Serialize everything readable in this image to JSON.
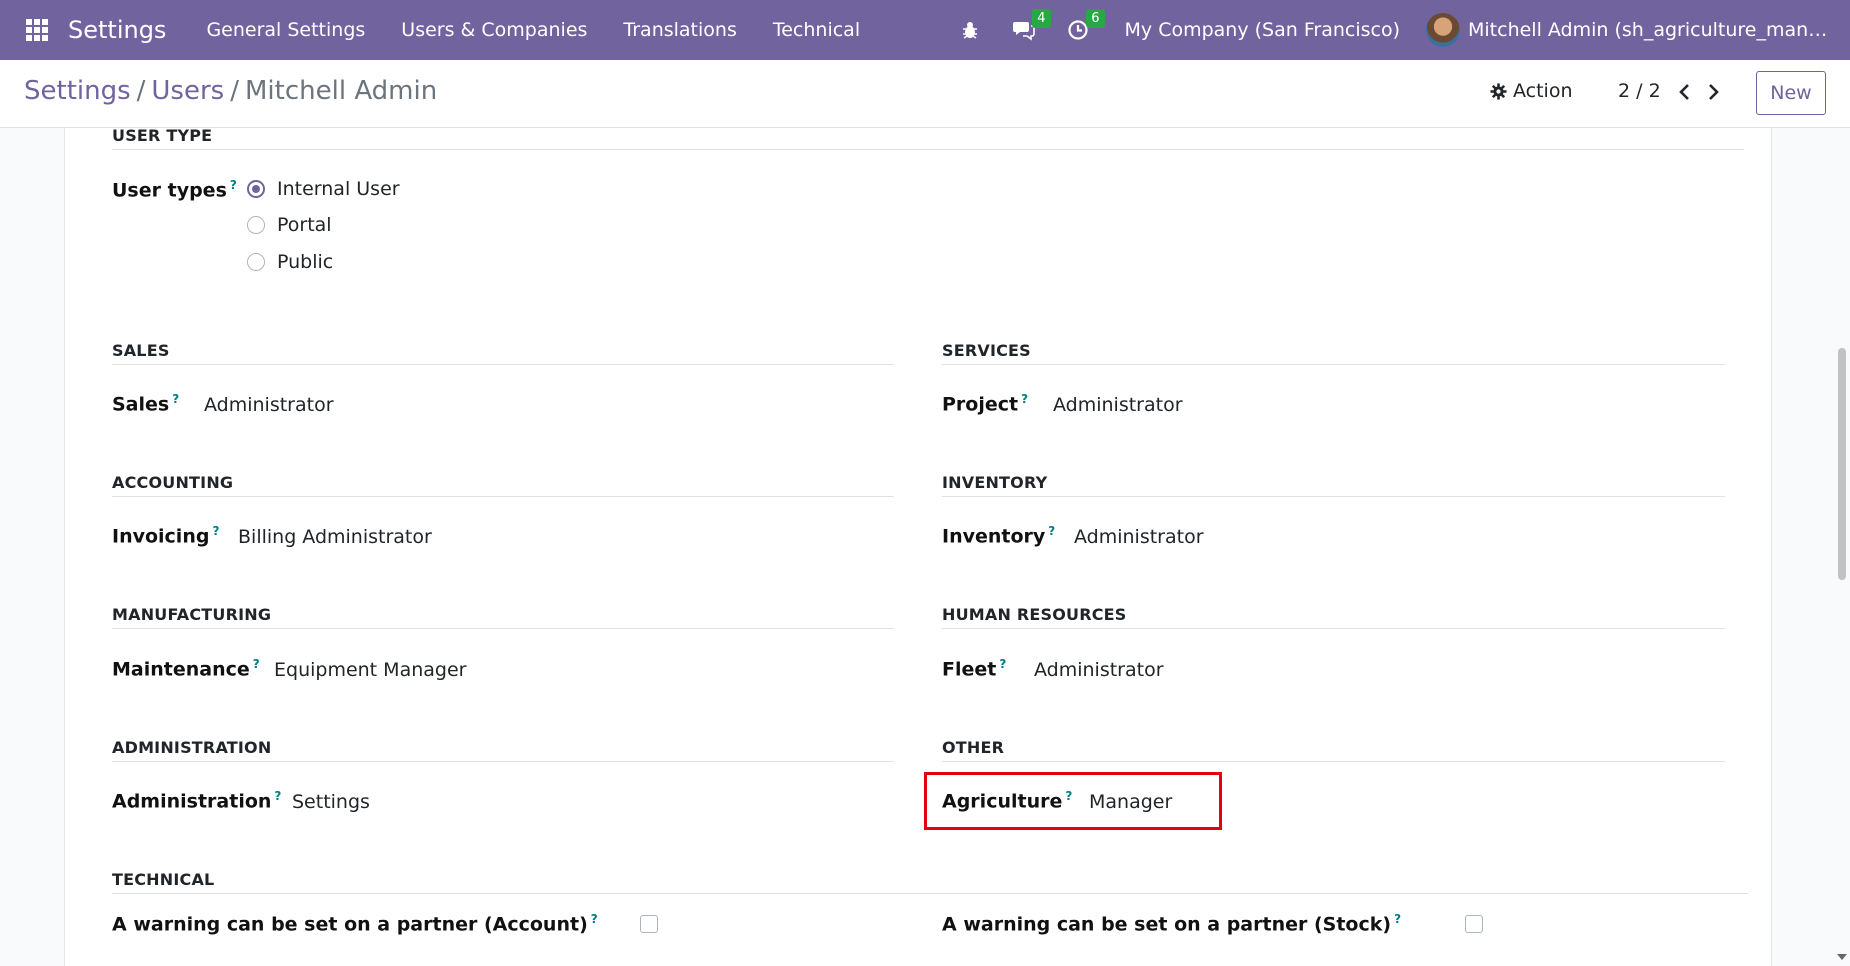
{
  "navbar": {
    "brand": "Settings",
    "menu": [
      "General Settings",
      "Users & Companies",
      "Translations",
      "Technical"
    ],
    "messages_count": "4",
    "activities_count": "6",
    "company": "My Company (San Francisco)",
    "user": "Mitchell Admin (sh_agriculture_manag..."
  },
  "control": {
    "breadcrumb": [
      "Settings",
      "Users",
      "Mitchell Admin"
    ],
    "separator": "/",
    "action_label": "Action",
    "pager": "2 / 2",
    "new_label": "New"
  },
  "user_type": {
    "title": "USER TYPE",
    "label": "User types",
    "help": "?",
    "options": [
      "Internal User",
      "Portal",
      "Public"
    ],
    "selected": "Internal User"
  },
  "groups": {
    "sales": {
      "title": "SALES",
      "label": "Sales",
      "value": "Administrator"
    },
    "services": {
      "title": "SERVICES",
      "label": "Project",
      "value": "Administrator"
    },
    "accounting": {
      "title": "ACCOUNTING",
      "label": "Invoicing",
      "value": "Billing Administrator"
    },
    "inventory": {
      "title": "INVENTORY",
      "label": "Inventory",
      "value": "Administrator"
    },
    "manufacturing": {
      "title": "MANUFACTURING",
      "label": "Maintenance",
      "value": "Equipment Manager"
    },
    "human_resources": {
      "title": "HUMAN RESOURCES",
      "label": "Fleet",
      "value": "Administrator"
    },
    "administration": {
      "title": "ADMINISTRATION",
      "label": "Administration",
      "value": "Settings"
    },
    "other": {
      "title": "OTHER",
      "label": "Agriculture",
      "value": "Manager"
    }
  },
  "technical": {
    "title": "TECHNICAL",
    "items": [
      {
        "label": "A warning can be set on a partner (Account)",
        "checked": false
      },
      {
        "label": "A warning can be set on a partner (Stock)",
        "checked": false
      }
    ]
  },
  "colors": {
    "brand": "#71639e",
    "badge": "#28a745",
    "help": "#017e84",
    "highlight": "#e3000f"
  },
  "icons": [
    "apps-grid-icon",
    "bug-icon",
    "chat-icon",
    "clock-icon",
    "gear-icon",
    "chevron-left-icon",
    "chevron-right-icon"
  ]
}
